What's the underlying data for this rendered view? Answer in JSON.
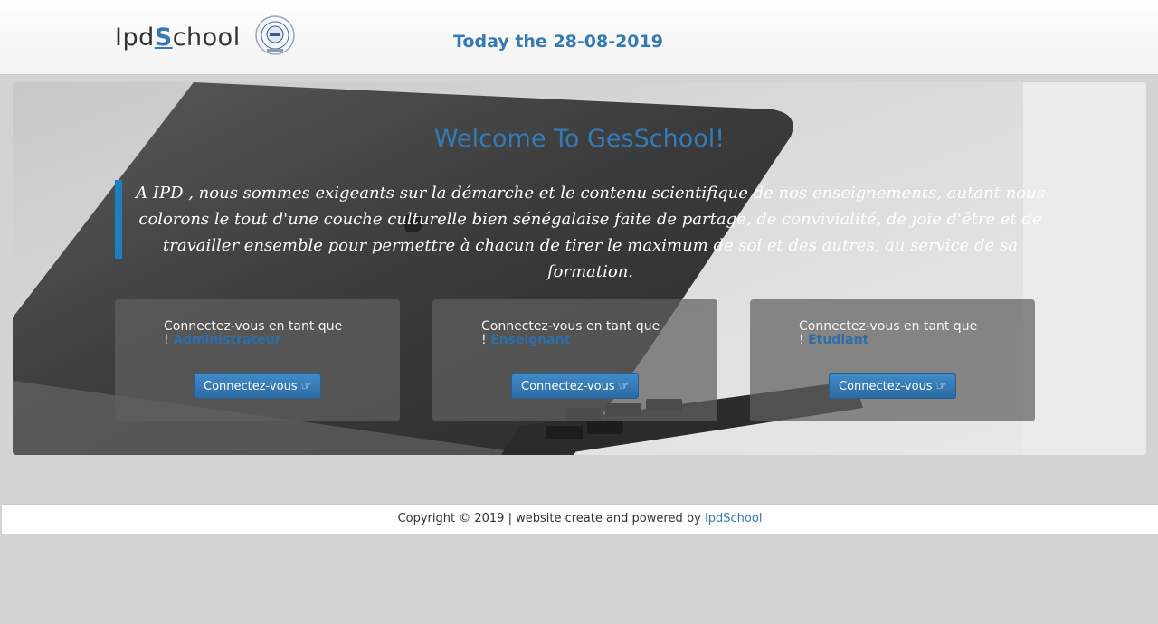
{
  "header": {
    "brand_prefix": "Ipd",
    "brand_initial": "S",
    "brand_suffix": "chool",
    "date_text": "Today the 28-08-2019"
  },
  "hero": {
    "title": "Welcome To GesSchool!",
    "quote": "A IPD , nous sommes exigeants sur la démarche et le contenu scientifique de nos enseignements, autant nous colorons le tout d'une couche culturelle bien sénégalaise faite de partage, de convivialité, de joie d'être et de travailler ensemble pour permettre à chacun de tirer le maximum de soi et des autres, au service de sa formation."
  },
  "cards": [
    {
      "prompt": "Connectez-vous en tant que",
      "bang": "!",
      "role": "Administrateur",
      "button": "Connectez-vous"
    },
    {
      "prompt": "Connectez-vous en tant que",
      "bang": "!",
      "role": "Enseignant",
      "button": "Connectez-vous"
    },
    {
      "prompt": "Connectez-vous en tant que",
      "bang": "!",
      "role": "Etudiant",
      "button": "Connectez-vous"
    }
  ],
  "footer": {
    "text": "Copyright © 2019 | website create and powered by",
    "link": "IpdSchool"
  },
  "colors": {
    "accent": "#337ab7",
    "quote_border": "#1b7fc0",
    "card_bg": "#5f5f5f"
  },
  "icons": {
    "login_button": "hand-point-right-icon"
  }
}
